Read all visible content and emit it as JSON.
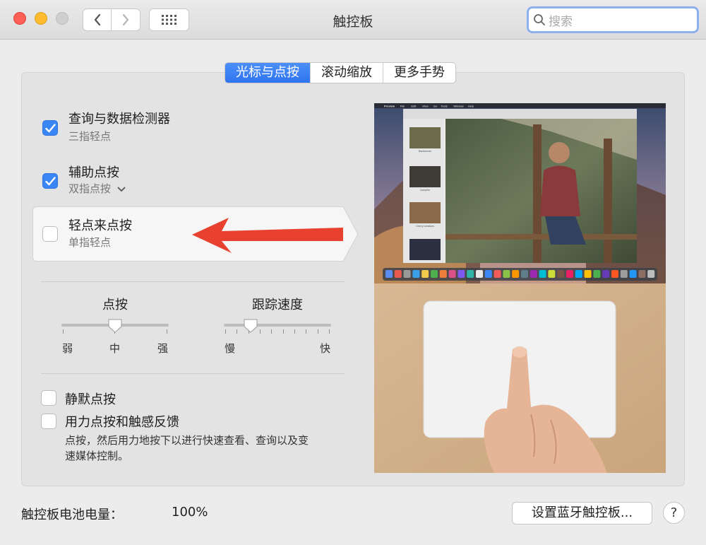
{
  "window": {
    "title": "触控板"
  },
  "search": {
    "placeholder": "搜索"
  },
  "tabs": [
    {
      "label": "光标与点按",
      "active": true
    },
    {
      "label": "滚动缩放",
      "active": false
    },
    {
      "label": "更多手势",
      "active": false
    }
  ],
  "options": [
    {
      "title": "查询与数据检测器",
      "subtitle": "三指轻点",
      "checked": true
    },
    {
      "title": "辅助点按",
      "subtitle": "双指点按",
      "checked": true,
      "has_dropdown": true
    },
    {
      "title": "轻点来点按",
      "subtitle": "单指轻点",
      "checked": false,
      "highlighted": true
    }
  ],
  "sliders": {
    "click": {
      "label": "点按",
      "min_label": "弱",
      "mid_label": "中",
      "max_label": "强",
      "value_fraction": 0.5
    },
    "tracking": {
      "label": "跟踪速度",
      "min_label": "慢",
      "max_label": "快",
      "value_fraction": 0.2
    }
  },
  "bottom_options": [
    {
      "title": "静默点按",
      "checked": false
    },
    {
      "title": "用力点按和触感反馈",
      "checked": false,
      "description_line1": "点按，然后用力地按下以进行快速查看、查询以及变",
      "description_line2": "速媒体控制。"
    }
  ],
  "footer": {
    "battery_label": "触控板电池电量：",
    "battery_value": "100%",
    "bluetooth_button": "设置蓝牙触控板...",
    "help": "?"
  },
  "colors": {
    "accent": "#3a86f5",
    "annotation_arrow": "#e8412f"
  },
  "preview": {
    "menu_app": "Preview",
    "menu_items": [
      "File",
      "Edit",
      "View",
      "Go",
      "Tools",
      "Window",
      "Help"
    ],
    "thumbnail_captions": [
      "Backwoods",
      "Campfire",
      "Cherry tomatoes"
    ]
  }
}
